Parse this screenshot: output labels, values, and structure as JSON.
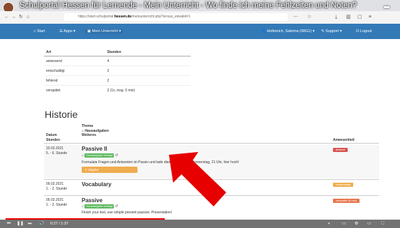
{
  "video": {
    "title": "Schulportal Hessen für Lernende - Mein Unterricht - Wo finde ich meine Fehlzeiten und Noten?",
    "time": "0:27 / 1:37",
    "progress": 0.41
  },
  "browser": {
    "url_prefix": "https://start.schulportal.",
    "url_domain": "hessen.de",
    "url_suffix": "/meinunterricht.php?a=sus_view&id=1"
  },
  "navbar": {
    "start": "Start",
    "apps": "Apps",
    "current": "Mein Unterricht",
    "user": "Holbreich, Sabrina (08G1)",
    "support": "Support",
    "logout": "Logout"
  },
  "absence_table": {
    "headers": [
      "Art",
      "Stunden"
    ],
    "rows": [
      [
        "anwesend",
        "4"
      ],
      [
        "entschuldigt",
        "2"
      ],
      [
        "fehlend",
        "2"
      ],
      [
        "verspätet",
        "2 (1x, insg. 5 min)"
      ]
    ]
  },
  "historie": {
    "heading": "Historie",
    "col_datum": "Datum",
    "col_stunden": "Stunden",
    "col_theme": "Thema",
    "col_hausaufgaben": "Hausaufgaben",
    "col_weiteres": "Weiteres",
    "col_anwesenheit": "Anwesenheit",
    "entries": [
      {
        "date": "10.02.2021",
        "hours": "5. - 6. Stunde",
        "title": "Passive II",
        "tag": "Hausaufgabe erledigt",
        "text": "Formulate Fragen und Antworten im Passiv und lade diese Abgabe bis Donnerstag, 21 Uhr, hier hoch!",
        "upload": "Abgabe",
        "status": "fehlend",
        "status_color": "#d9534f"
      },
      {
        "date": "09.02.2021",
        "hours": "1. - 2. Stunde",
        "title": "Vocabulary",
        "status": "entschuldigt",
        "status_color": "#f0ad4e"
      },
      {
        "date": "05.02.2021",
        "hours": "1. - 2. Stunde",
        "title": "Passive",
        "tag": "Hausaufgabe erledigt",
        "text": "Finish your text, use simple present passive. Presentation!",
        "status": "verspätet (5 min)",
        "status_color": "#e8734a"
      }
    ]
  },
  "colors": {
    "navbar": "#337ab7",
    "arrow": "#e60000",
    "progress": "#e00000"
  }
}
